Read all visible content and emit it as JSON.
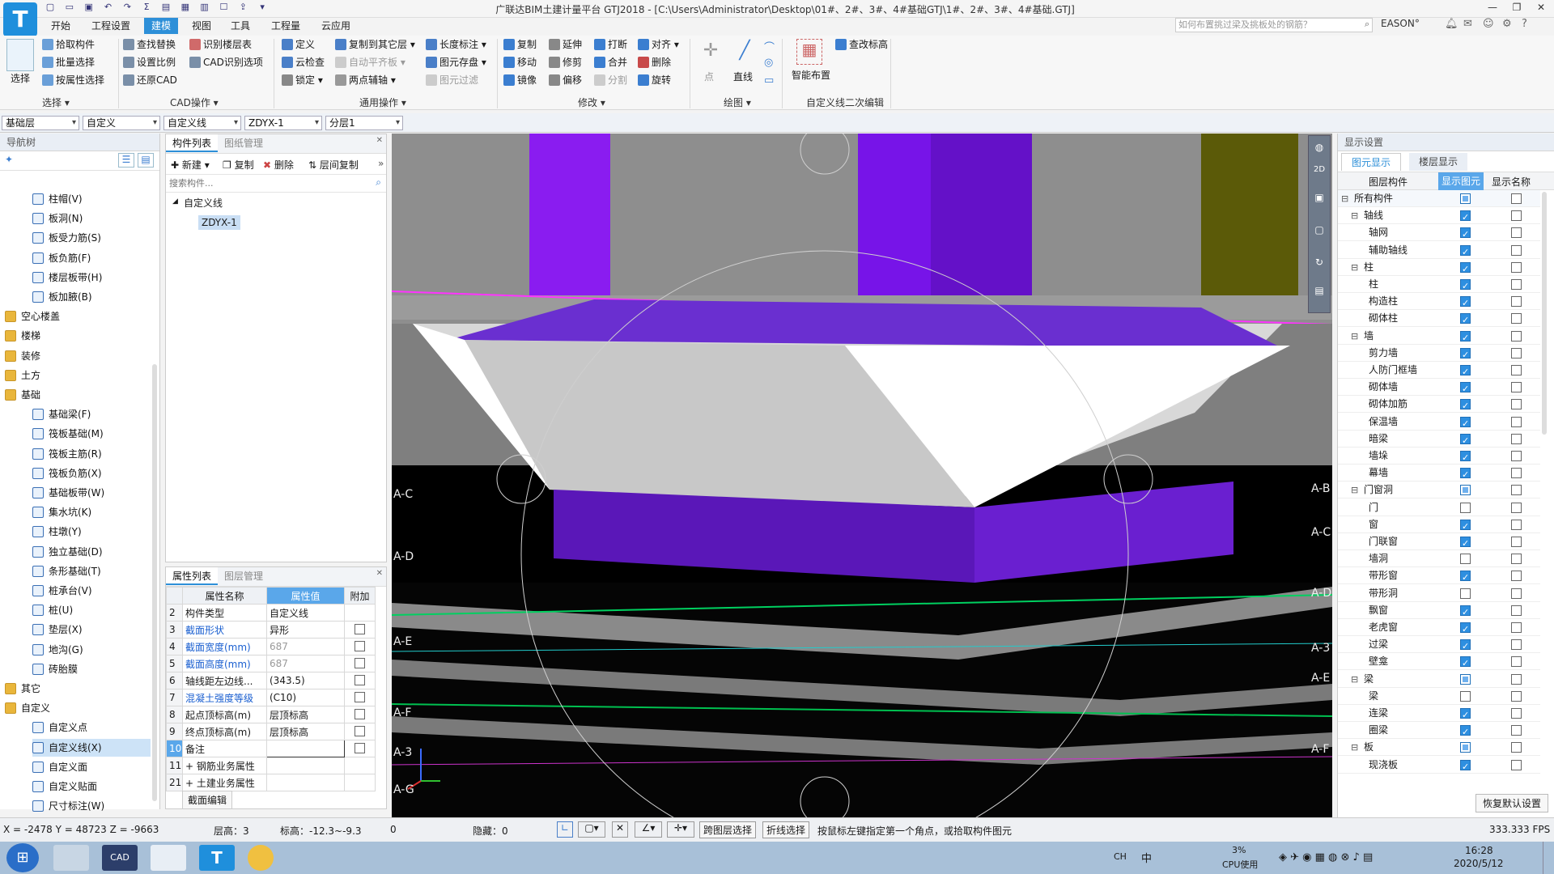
{
  "app": {
    "title": "广联达BIM土建计量平台 GTJ2018 - [C:\\Users\\Administrator\\Desktop\\01#、2#、3#、4#基础GTJ\\1#、2#、3#、4#基础.GTJ]",
    "logo": "T",
    "search_placeholder": "如何布置挑过梁及挑板处的钢筋？",
    "user": "EASON°"
  },
  "menu_tabs": [
    "开始",
    "工程设置",
    "建模",
    "视图",
    "工具",
    "工程量",
    "云应用"
  ],
  "ribbon": {
    "select": {
      "big": "选择",
      "items": [
        "拾取构件",
        "批量选择",
        "按属性选择"
      ],
      "label": "选择 ▾"
    },
    "cad": {
      "items": [
        "查找替换",
        "设置比例",
        "还原CAD",
        "识别楼层表",
        "CAD识别选项"
      ],
      "label": "CAD操作 ▾"
    },
    "general": {
      "items": [
        "定义",
        "云检查",
        "锁定 ▾",
        "复制到其它层 ▾",
        "自动平齐板 ▾",
        "两点辅轴 ▾",
        "长度标注 ▾",
        "图元存盘 ▾",
        "图元过滤"
      ],
      "label": "通用操作 ▾"
    },
    "modify": {
      "items": [
        "复制",
        "移动",
        "镜像",
        "延伸",
        "修剪",
        "偏移",
        "打断",
        "合并",
        "分割",
        "对齐 ▾",
        "删除",
        "旋转"
      ],
      "label": "修改 ▾"
    },
    "draw": {
      "items": [
        "点",
        "直线"
      ],
      "label": "绘图 ▾"
    },
    "custom": {
      "items": [
        "智能布置",
        "查改标高"
      ],
      "label": "自定义线二次编辑"
    }
  },
  "selectors": [
    "基础层",
    "自定义",
    "自定义线",
    "ZDYX-1",
    "分层1"
  ],
  "nav": {
    "title": "导航树",
    "items": [
      {
        "label": "柱帽(V)",
        "level": 2
      },
      {
        "label": "板洞(N)",
        "level": 2
      },
      {
        "label": "板受力筋(S)",
        "level": 2
      },
      {
        "label": "板负筋(F)",
        "level": 2
      },
      {
        "label": "楼层板带(H)",
        "level": 2
      },
      {
        "label": "板加腋(B)",
        "level": 2
      },
      {
        "label": "空心楼盖",
        "level": 1
      },
      {
        "label": "楼梯",
        "level": 1
      },
      {
        "label": "装修",
        "level": 1
      },
      {
        "label": "土方",
        "level": 1
      },
      {
        "label": "基础",
        "level": 1
      },
      {
        "label": "基础梁(F)",
        "level": 2
      },
      {
        "label": "筏板基础(M)",
        "level": 2
      },
      {
        "label": "筏板主筋(R)",
        "level": 2
      },
      {
        "label": "筏板负筋(X)",
        "level": 2
      },
      {
        "label": "基础板带(W)",
        "level": 2
      },
      {
        "label": "集水坑(K)",
        "level": 2
      },
      {
        "label": "柱墩(Y)",
        "level": 2
      },
      {
        "label": "独立基础(D)",
        "level": 2
      },
      {
        "label": "条形基础(T)",
        "level": 2
      },
      {
        "label": "桩承台(V)",
        "level": 2
      },
      {
        "label": "桩(U)",
        "level": 2
      },
      {
        "label": "垫层(X)",
        "level": 2
      },
      {
        "label": "地沟(G)",
        "level": 2
      },
      {
        "label": "砖胎膜",
        "level": 2
      },
      {
        "label": "其它",
        "level": 1
      },
      {
        "label": "自定义",
        "level": 1
      },
      {
        "label": "自定义点",
        "level": 2
      },
      {
        "label": "自定义线(X)",
        "level": 2,
        "selected": true
      },
      {
        "label": "自定义面",
        "level": 2
      },
      {
        "label": "自定义贴面",
        "level": 2
      },
      {
        "label": "尺寸标注(W)",
        "level": 2
      }
    ]
  },
  "complist": {
    "tabs": [
      "构件列表",
      "图纸管理"
    ],
    "toolbar": [
      "新建 ▾",
      "复制",
      "删除",
      "层间复制"
    ],
    "search_placeholder": "搜索构件...",
    "group": "自定义线",
    "item": "ZDYX-1"
  },
  "props": {
    "tabs": [
      "属性列表",
      "图层管理"
    ],
    "headers": [
      "属性名称",
      "属性值",
      "附加"
    ],
    "rows": [
      {
        "n": "2",
        "name": "构件类型",
        "value": "自定义线",
        "blue": false,
        "cb": false
      },
      {
        "n": "3",
        "name": "截面形状",
        "value": "异形",
        "blue": true,
        "cb": true
      },
      {
        "n": "4",
        "name": "截面宽度(mm)",
        "value": "687",
        "blue": true,
        "cb": true,
        "gray": true
      },
      {
        "n": "5",
        "name": "截面高度(mm)",
        "value": "687",
        "blue": true,
        "cb": true,
        "gray": true
      },
      {
        "n": "6",
        "name": "轴线距左边线...",
        "value": "(343.5)",
        "blue": false,
        "cb": true
      },
      {
        "n": "7",
        "name": "混凝土强度等级",
        "value": "(C10)",
        "blue": true,
        "cb": true
      },
      {
        "n": "8",
        "name": "起点顶标高(m)",
        "value": "层顶标高",
        "blue": false,
        "cb": true
      },
      {
        "n": "9",
        "name": "终点顶标高(m)",
        "value": "层顶标高",
        "blue": false,
        "cb": true
      },
      {
        "n": "10",
        "name": "备注",
        "value": "",
        "blue": false,
        "cb": true
      },
      {
        "n": "11",
        "name": "+ 钢筋业务属性",
        "value": "",
        "blue": false,
        "cb": false
      },
      {
        "n": "21",
        "name": "+ 土建业务属性",
        "value": "",
        "blue": false,
        "cb": false
      }
    ],
    "footer": "截面编辑"
  },
  "viewport": {
    "axis_labels": [
      "A-C",
      "A-D",
      "A-E",
      "A-F",
      "A-3",
      "A-G",
      "A-B",
      "A-C",
      "A-D",
      "A-3",
      "A-E",
      "A-F"
    ]
  },
  "display": {
    "title": "显示设置",
    "tabs": [
      "图元显示",
      "楼层显示"
    ],
    "headers": [
      "图层构件",
      "显示图元",
      "显示名称"
    ],
    "rows": [
      {
        "label": "所有构件",
        "l": 0,
        "a": "part",
        "b": false
      },
      {
        "label": "轴线",
        "l": 1,
        "a": "on",
        "b": false
      },
      {
        "label": "轴网",
        "l": 2,
        "a": "on",
        "b": false
      },
      {
        "label": "辅助轴线",
        "l": 2,
        "a": "on",
        "b": false
      },
      {
        "label": "柱",
        "l": 1,
        "a": "on",
        "b": false
      },
      {
        "label": "柱",
        "l": 2,
        "a": "on",
        "b": false
      },
      {
        "label": "构造柱",
        "l": 2,
        "a": "on",
        "b": false
      },
      {
        "label": "砌体柱",
        "l": 2,
        "a": "on",
        "b": false
      },
      {
        "label": "墙",
        "l": 1,
        "a": "on",
        "b": false
      },
      {
        "label": "剪力墙",
        "l": 2,
        "a": "on",
        "b": false
      },
      {
        "label": "人防门框墙",
        "l": 2,
        "a": "on",
        "b": false
      },
      {
        "label": "砌体墙",
        "l": 2,
        "a": "on",
        "b": false
      },
      {
        "label": "砌体加筋",
        "l": 2,
        "a": "on",
        "b": false
      },
      {
        "label": "保温墙",
        "l": 2,
        "a": "on",
        "b": false
      },
      {
        "label": "暗梁",
        "l": 2,
        "a": "on",
        "b": false
      },
      {
        "label": "墙垛",
        "l": 2,
        "a": "on",
        "b": false
      },
      {
        "label": "幕墙",
        "l": 2,
        "a": "on",
        "b": false
      },
      {
        "label": "门窗洞",
        "l": 1,
        "a": "part",
        "b": false
      },
      {
        "label": "门",
        "l": 2,
        "a": "off",
        "b": false
      },
      {
        "label": "窗",
        "l": 2,
        "a": "on",
        "b": false
      },
      {
        "label": "门联窗",
        "l": 2,
        "a": "on",
        "b": false
      },
      {
        "label": "墙洞",
        "l": 2,
        "a": "off",
        "b": false
      },
      {
        "label": "带形窗",
        "l": 2,
        "a": "on",
        "b": false
      },
      {
        "label": "带形洞",
        "l": 2,
        "a": "off",
        "b": false
      },
      {
        "label": "飘窗",
        "l": 2,
        "a": "on",
        "b": false
      },
      {
        "label": "老虎窗",
        "l": 2,
        "a": "on",
        "b": false
      },
      {
        "label": "过梁",
        "l": 2,
        "a": "on",
        "b": false
      },
      {
        "label": "壁龛",
        "l": 2,
        "a": "on",
        "b": false
      },
      {
        "label": "梁",
        "l": 1,
        "a": "part",
        "b": false
      },
      {
        "label": "梁",
        "l": 2,
        "a": "off",
        "b": false
      },
      {
        "label": "连梁",
        "l": 2,
        "a": "on",
        "b": false
      },
      {
        "label": "圈梁",
        "l": 2,
        "a": "on",
        "b": false
      },
      {
        "label": "板",
        "l": 1,
        "a": "part",
        "b": false
      },
      {
        "label": "现浇板",
        "l": 2,
        "a": "on",
        "b": false
      }
    ],
    "restore": "恢复默认设置"
  },
  "status": {
    "coords": "X = -2478 Y = 48723 Z = -9663",
    "floor_h": "层高：3",
    "elev": "标高：-12.3~-9.3",
    "zero": "0",
    "hidden": "隐藏：0",
    "btn1": "跨图层选择",
    "btn2": "折线选择",
    "hint": "按鼠标左键指定第一个角点，或拾取构件图元",
    "fps": "333.333 FPS"
  },
  "taskbar": {
    "cpu_pct": "3%",
    "cpu_label": "CPU使用",
    "time": "16:28",
    "date": "2020/5/12",
    "lang": "CH",
    "ime": "中"
  }
}
